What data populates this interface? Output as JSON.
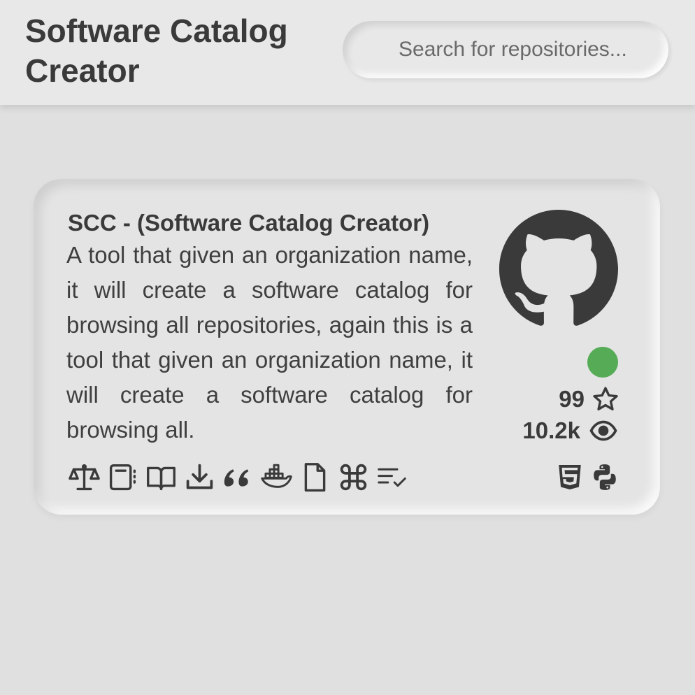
{
  "header": {
    "title": "Software Catalog Creator",
    "search_placeholder": "Search for repositories..."
  },
  "repository": {
    "title": "SCC - (Software Catalog Creator)",
    "description": "A tool that given an organization name, it will create a software catalog for browsing all repositories, again this is a tool that given an organization name, it will create a software catalog for browsing all.",
    "host_icon": "github-icon",
    "status_color": "#56ab56",
    "stars": "99",
    "views": "10.2k",
    "tool_icons": [
      "license-scale-icon",
      "notebook-icon",
      "docs-book-icon",
      "download-icon",
      "quote-icon",
      "docker-icon",
      "file-icon",
      "command-icon",
      "checklist-icon"
    ],
    "languages": [
      "html5-icon",
      "python-icon"
    ]
  }
}
